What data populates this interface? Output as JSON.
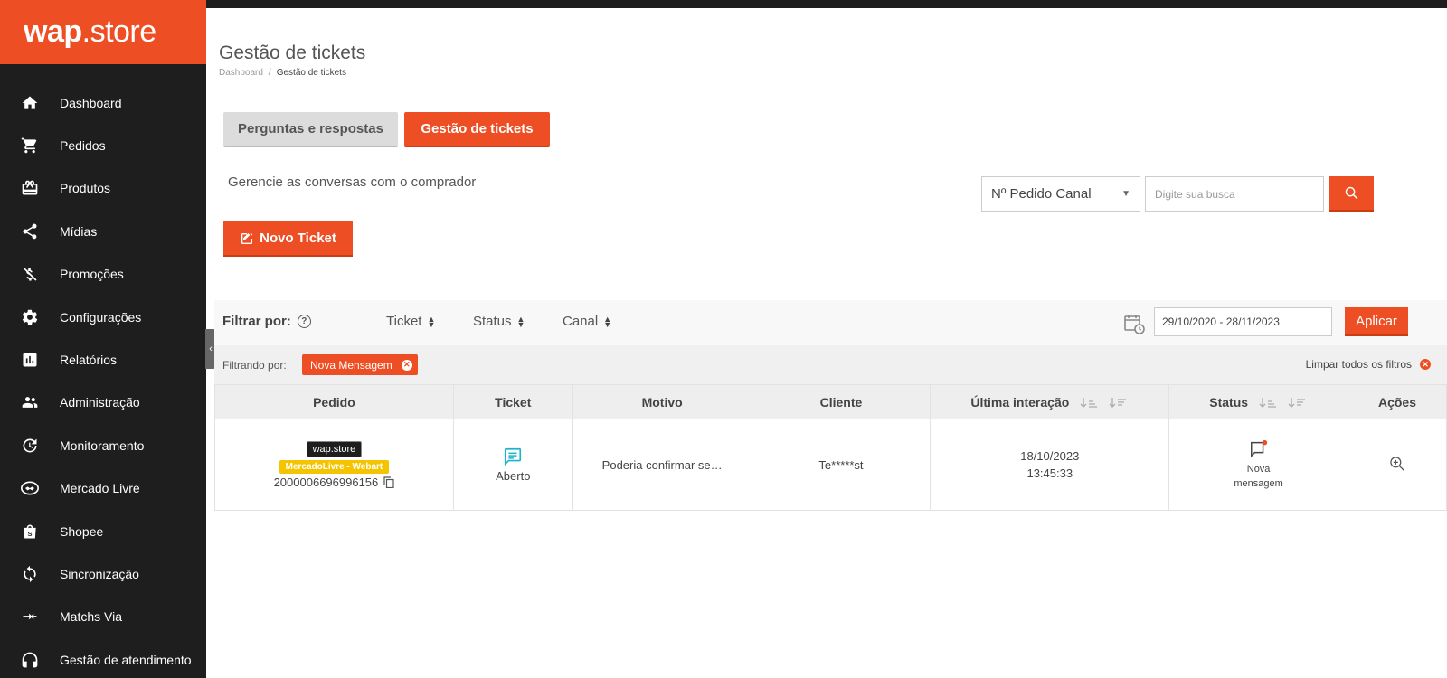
{
  "brand": {
    "logo_bold": "wap",
    "logo_rest": ".store",
    "accent": "#ee4e23",
    "sidebar_bg": "#1e1e1e"
  },
  "sidebar": {
    "items": [
      {
        "label": "Dashboard",
        "icon": "home-icon"
      },
      {
        "label": "Pedidos",
        "icon": "cart-icon"
      },
      {
        "label": "Produtos",
        "icon": "gift-icon"
      },
      {
        "label": "Mídias",
        "icon": "share-icon"
      },
      {
        "label": "Promoções",
        "icon": "discount-icon"
      },
      {
        "label": "Configurações",
        "icon": "gear-icon"
      },
      {
        "label": "Relatórios",
        "icon": "chart-icon"
      },
      {
        "label": "Administração",
        "icon": "users-icon"
      },
      {
        "label": "Monitoramento",
        "icon": "monitor-icon"
      },
      {
        "label": "Mercado Livre",
        "icon": "handshake-icon"
      },
      {
        "label": "Shopee",
        "icon": "shopping-bag-icon"
      },
      {
        "label": "Sincronização",
        "icon": "sync-icon"
      },
      {
        "label": "Matchs Via",
        "icon": "merge-icon"
      },
      {
        "label": "Gestão de atendimento",
        "icon": "headset-icon"
      }
    ]
  },
  "header": {
    "title": "Gestão de tickets",
    "breadcrumb": [
      "Dashboard",
      "Gestão de tickets"
    ]
  },
  "tabs": [
    {
      "label": "Perguntas e respostas"
    },
    {
      "label": "Gestão de tickets"
    }
  ],
  "subtitle": "Gerencie as conversas com o comprador",
  "new_ticket_label": "Novo Ticket",
  "search": {
    "select_value": "Nº Pedido Canal",
    "placeholder": "Digite sua busca"
  },
  "filters": {
    "title": "Filtrar por:",
    "dropdowns": [
      "Ticket",
      "Status",
      "Canal"
    ],
    "date_range": "29/10/2020 - 28/11/2023",
    "apply_label": "Aplicar",
    "active_label": "Filtrando por:",
    "active_chip": "Nova Mensagem",
    "clear_all": "Limpar todos os filtros"
  },
  "table": {
    "columns": [
      "Pedido",
      "Ticket",
      "Motivo",
      "Cliente",
      "Última interação",
      "Status",
      "Ações"
    ],
    "rows": [
      {
        "store": "wap.store",
        "channel": "MercadoLivre - Webart",
        "order": "2000006696996156",
        "ticket": "Aberto",
        "motivo": "Poderia confirmar se…",
        "cliente": "Te*****st",
        "date": "18/10/2023",
        "time": "13:45:33",
        "status_line1": "Nova",
        "status_line2": "mensagem"
      }
    ]
  }
}
